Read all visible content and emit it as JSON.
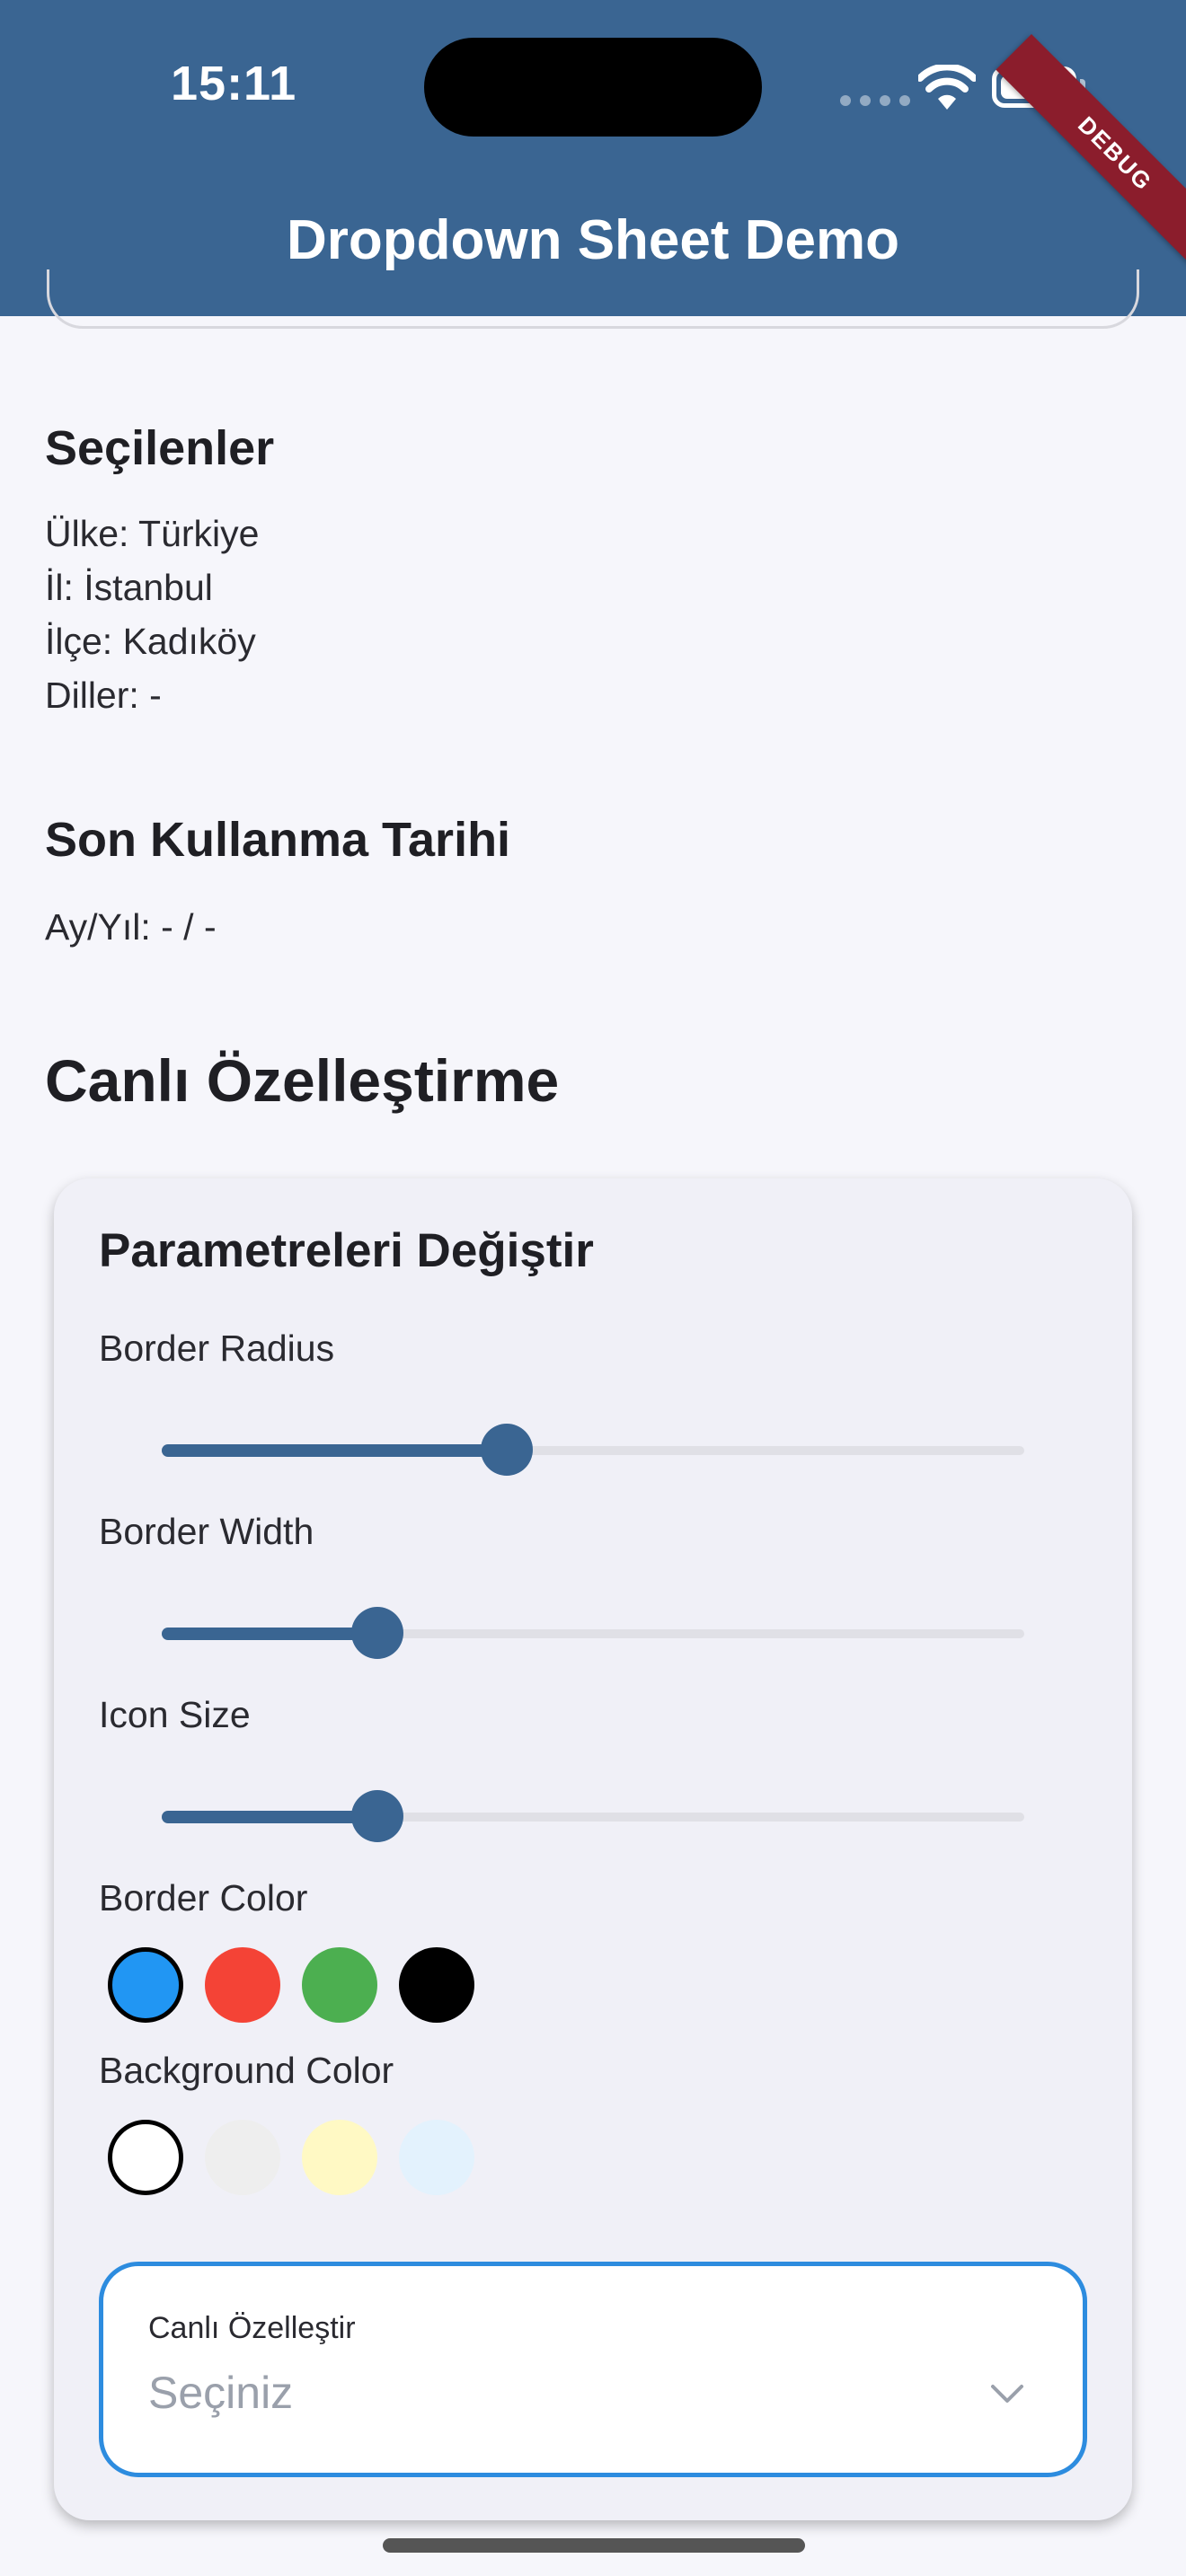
{
  "status_bar": {
    "time": "15:11"
  },
  "app_bar": {
    "title": "Dropdown Sheet Demo",
    "debug_banner": "DEBUG"
  },
  "selected_section": {
    "title": "Seçilenler",
    "lines": [
      "Ülke: Türkiye",
      "İl: İstanbul",
      "İlçe: Kadıköy",
      "Diller: -"
    ]
  },
  "expiry_section": {
    "title": "Son Kullanma Tarihi",
    "value": "Ay/Yıl: - / -"
  },
  "live_section": {
    "title": "Canlı Özelleştirme"
  },
  "card": {
    "title": "Parametreleri Değiştir",
    "sliders": [
      {
        "label": "Border Radius",
        "value_fraction": 0.4
      },
      {
        "label": "Border Width",
        "value_fraction": 0.25
      },
      {
        "label": "Icon Size",
        "value_fraction": 0.25
      }
    ],
    "border_color": {
      "label": "Border Color",
      "options": [
        "#2196f3",
        "#f44336",
        "#4caf50",
        "#000000"
      ],
      "selected": "#2196f3"
    },
    "background_color": {
      "label": "Background Color",
      "options": [
        "#ffffff",
        "#eeeeee",
        "#fff9c4",
        "#e3f2fd"
      ],
      "selected": "#ffffff"
    },
    "dropdown": {
      "label": "Canlı Özelleştir",
      "placeholder": "Seçiniz"
    }
  },
  "colors": {
    "primary": "#3a6592",
    "accent": "#2d8cdf"
  }
}
